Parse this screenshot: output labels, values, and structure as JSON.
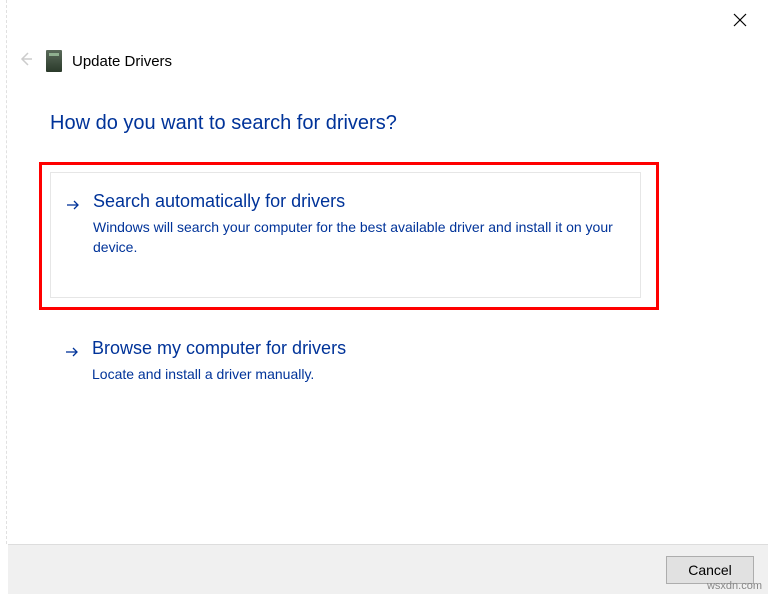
{
  "window": {
    "title": "Update Drivers"
  },
  "heading": "How do you want to search for drivers?",
  "options": {
    "auto": {
      "title": "Search automatically for drivers",
      "desc": "Windows will search your computer for the best available driver and install it on your device."
    },
    "browse": {
      "title": "Browse my computer for drivers",
      "desc": "Locate and install a driver manually."
    }
  },
  "footer": {
    "cancel": "Cancel"
  },
  "watermark": "wsxdn.com"
}
